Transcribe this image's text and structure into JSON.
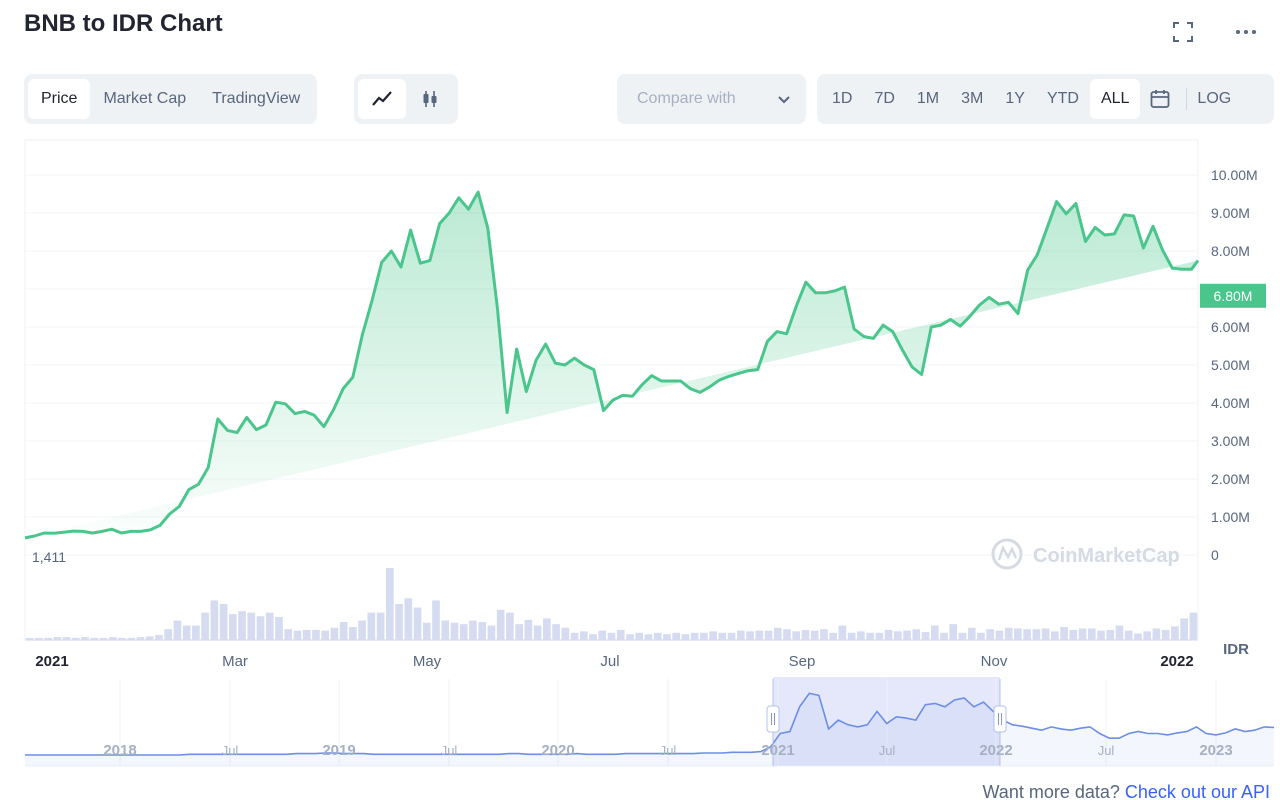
{
  "header": {
    "title": "BNB to IDR Chart",
    "fullscreen_icon": "fullscreen-icon",
    "more_icon": "more-icon"
  },
  "tabs": [
    {
      "label": "Price",
      "active": true
    },
    {
      "label": "Market Cap",
      "active": false
    },
    {
      "label": "TradingView",
      "active": false
    }
  ],
  "chart_style": {
    "line_icon": "line-chart-icon",
    "candle_icon": "candlestick-icon",
    "active": "line"
  },
  "compare": {
    "placeholder": "Compare with",
    "icon": "chevron-down-icon"
  },
  "ranges": [
    {
      "label": "1D",
      "active": false
    },
    {
      "label": "7D",
      "active": false
    },
    {
      "label": "1M",
      "active": false
    },
    {
      "label": "3M",
      "active": false
    },
    {
      "label": "1Y",
      "active": false
    },
    {
      "label": "YTD",
      "active": false
    },
    {
      "label": "ALL",
      "active": true
    }
  ],
  "calendar_icon": "calendar-icon",
  "log_label": "LOG",
  "footer": {
    "text": "Want more data?",
    "link": "Check out our API"
  },
  "colors": {
    "line": "#4ac68c",
    "brush": "#6c8ee6",
    "accent": "#3861fb"
  },
  "chart_data": {
    "type": "area",
    "x": [
      "2021-01-01",
      "2021-01-04",
      "2021-01-07",
      "2021-01-10",
      "2021-01-13",
      "2021-01-16",
      "2021-01-19",
      "2021-01-22",
      "2021-01-25",
      "2021-01-28",
      "2021-01-31",
      "2021-02-03",
      "2021-02-06",
      "2021-02-09",
      "2021-02-12",
      "2021-02-15",
      "2021-02-18",
      "2021-02-21",
      "2021-02-24",
      "2021-02-27",
      "2021-03-02",
      "2021-03-05",
      "2021-03-08",
      "2021-03-11",
      "2021-03-14",
      "2021-03-17",
      "2021-03-20",
      "2021-03-23",
      "2021-03-26",
      "2021-03-29",
      "2021-04-01",
      "2021-04-04",
      "2021-04-07",
      "2021-04-10",
      "2021-04-13",
      "2021-04-16",
      "2021-04-19",
      "2021-04-22",
      "2021-04-25",
      "2021-04-28",
      "2021-05-01",
      "2021-05-04",
      "2021-05-07",
      "2021-05-10",
      "2021-05-13",
      "2021-05-16",
      "2021-05-19",
      "2021-05-22",
      "2021-05-25",
      "2021-05-28",
      "2021-05-31",
      "2021-06-03",
      "2021-06-06",
      "2021-06-09",
      "2021-06-12",
      "2021-06-15",
      "2021-06-18",
      "2021-06-21",
      "2021-06-24",
      "2021-06-27",
      "2021-06-30",
      "2021-07-03",
      "2021-07-06",
      "2021-07-09",
      "2021-07-12",
      "2021-07-15",
      "2021-07-18",
      "2021-07-21",
      "2021-07-24",
      "2021-07-27",
      "2021-07-30",
      "2021-08-02",
      "2021-08-05",
      "2021-08-08",
      "2021-08-11",
      "2021-08-14",
      "2021-08-17",
      "2021-08-20",
      "2021-08-23",
      "2021-08-26",
      "2021-08-29",
      "2021-09-01",
      "2021-09-04",
      "2021-09-07",
      "2021-09-10",
      "2021-09-13",
      "2021-09-16",
      "2021-09-19",
      "2021-09-22",
      "2021-09-25",
      "2021-09-28",
      "2021-10-01",
      "2021-10-04",
      "2021-10-07",
      "2021-10-10",
      "2021-10-13",
      "2021-10-16",
      "2021-10-19",
      "2021-10-22",
      "2021-10-25",
      "2021-10-28",
      "2021-10-31",
      "2021-11-03",
      "2021-11-06",
      "2021-11-09",
      "2021-11-12",
      "2021-11-15",
      "2021-11-18",
      "2021-11-21",
      "2021-11-24",
      "2021-11-27",
      "2021-11-30",
      "2021-12-03",
      "2021-12-06",
      "2021-12-09",
      "2021-12-12",
      "2021-12-15",
      "2021-12-18",
      "2021-12-21",
      "2021-12-24",
      "2021-12-27",
      "2021-12-30",
      "2022-01-01"
    ],
    "price": [
      0.45,
      0.5,
      0.58,
      0.57,
      0.6,
      0.63,
      0.62,
      0.58,
      0.62,
      0.68,
      0.58,
      0.62,
      0.62,
      0.66,
      0.78,
      1.08,
      1.28,
      1.72,
      1.86,
      2.3,
      3.58,
      3.28,
      3.22,
      3.62,
      3.3,
      3.42,
      4.02,
      3.98,
      3.72,
      3.78,
      3.68,
      3.38,
      3.82,
      4.38,
      4.68,
      5.8,
      6.7,
      7.7,
      8.0,
      7.58,
      8.55,
      7.68,
      7.75,
      8.72,
      9.0,
      9.4,
      9.1,
      9.55,
      8.6,
      6.5,
      3.75,
      5.42,
      4.3,
      5.12,
      5.55,
      5.05,
      5.0,
      5.18,
      5.0,
      4.88,
      3.8,
      4.08,
      4.2,
      4.18,
      4.48,
      4.72,
      4.58,
      4.58,
      4.58,
      4.38,
      4.28,
      4.42,
      4.6,
      4.7,
      4.78,
      4.85,
      4.88,
      5.62,
      5.88,
      5.82,
      6.55,
      7.18,
      6.9,
      6.9,
      6.95,
      7.05,
      5.95,
      5.75,
      5.7,
      6.05,
      5.88,
      5.4,
      4.95,
      4.75,
      6.0,
      6.05,
      6.2,
      6.02,
      6.28,
      6.58,
      6.78,
      6.6,
      6.65,
      6.35,
      7.5,
      7.9,
      8.6,
      9.3,
      8.98,
      9.25,
      8.25,
      8.62,
      8.42,
      8.45,
      8.95,
      8.92,
      8.08,
      8.65,
      8.02,
      7.55,
      7.52,
      7.52,
      7.75,
      7.72,
      7.3,
      7.45,
      7.22,
      6.82
    ],
    "volume": [
      0.03,
      0.03,
      0.03,
      0.04,
      0.04,
      0.03,
      0.04,
      0.03,
      0.03,
      0.04,
      0.03,
      0.03,
      0.04,
      0.05,
      0.07,
      0.15,
      0.27,
      0.2,
      0.2,
      0.38,
      0.55,
      0.5,
      0.36,
      0.4,
      0.38,
      0.33,
      0.38,
      0.32,
      0.15,
      0.13,
      0.14,
      0.14,
      0.13,
      0.17,
      0.25,
      0.18,
      0.27,
      0.38,
      0.38,
      1.0,
      0.5,
      0.58,
      0.45,
      0.24,
      0.55,
      0.27,
      0.24,
      0.22,
      0.27,
      0.25,
      0.2,
      0.42,
      0.38,
      0.22,
      0.28,
      0.2,
      0.3,
      0.22,
      0.17,
      0.1,
      0.12,
      0.08,
      0.13,
      0.1,
      0.14,
      0.08,
      0.1,
      0.08,
      0.1,
      0.08,
      0.1,
      0.08,
      0.1,
      0.1,
      0.12,
      0.1,
      0.1,
      0.13,
      0.12,
      0.13,
      0.13,
      0.17,
      0.15,
      0.12,
      0.14,
      0.13,
      0.15,
      0.1,
      0.2,
      0.1,
      0.12,
      0.1,
      0.1,
      0.14,
      0.12,
      0.13,
      0.15,
      0.11,
      0.2,
      0.1,
      0.22,
      0.1,
      0.17,
      0.1,
      0.15,
      0.13,
      0.17,
      0.16,
      0.15,
      0.15,
      0.16,
      0.12,
      0.18,
      0.14,
      0.16,
      0.16,
      0.13,
      0.14,
      0.2,
      0.13,
      0.09,
      0.12,
      0.16,
      0.14,
      0.19,
      0.3,
      0.38
    ],
    "ylim": [
      0,
      10000000
    ],
    "y_ticks": [
      "10.00M",
      "9.00M",
      "8.00M",
      "7.00M",
      "6.00M",
      "5.00M",
      "4.00M",
      "3.00M",
      "2.00M",
      "1.00M",
      "0"
    ],
    "x_ticks": [
      "2021",
      "Mar",
      "May",
      "Jul",
      "Sep",
      "Nov",
      "2022"
    ],
    "current_price_label": "6.80M",
    "volume_label": "1,411",
    "currency_label": "IDR",
    "watermark": "CoinMarketCap",
    "navigator": {
      "x_ticks": [
        "2018",
        "Jul",
        "2019",
        "Jul",
        "2020",
        "Jul",
        "2021",
        "Jul",
        "2022",
        "Jul",
        "2023"
      ],
      "selected_range": [
        "2021-01-01",
        "2022-01-01"
      ],
      "series": [
        0.3,
        0.3,
        0.3,
        0.3,
        0.3,
        0.3,
        0.3,
        0.3,
        0.3,
        0.3,
        0.3,
        0.3,
        0.3,
        0.3,
        0.3,
        0.3,
        0.3,
        0.4,
        0.4,
        0.4,
        0.4,
        0.4,
        0.4,
        0.4,
        0.4,
        0.4,
        0.4,
        0.4,
        0.5,
        0.5,
        0.5,
        0.6,
        0.6,
        0.5,
        0.5,
        0.5,
        0.4,
        0.4,
        0.4,
        0.4,
        0.4,
        0.4,
        0.4,
        0.4,
        0.4,
        0.4,
        0.4,
        0.4,
        0.4,
        0.4,
        0.5,
        0.5,
        0.4,
        0.4,
        0.4,
        0.4,
        0.4,
        0.5,
        0.4,
        0.4,
        0.4,
        0.4,
        0.5,
        0.5,
        0.5,
        0.5,
        0.5,
        0.5,
        0.5,
        0.5,
        0.6,
        0.6,
        0.6,
        0.7,
        0.7,
        0.7,
        0.8,
        1.5,
        3.5,
        3.8,
        7.5,
        9.5,
        9.2,
        4.2,
        5.5,
        4.8,
        4.5,
        4.8,
        6.8,
        5.0,
        6.0,
        5.8,
        5.5,
        7.8,
        8.0,
        7.5,
        8.5,
        8.8,
        7.5,
        8.2,
        6.8,
        5.5,
        4.8,
        4.6,
        4.3,
        4.0,
        4.5,
        4.2,
        4.0,
        4.3,
        4.5,
        3.5,
        2.8,
        2.8,
        3.5,
        3.8,
        3.5,
        3.5,
        3.3,
        3.6,
        3.8,
        4.5,
        3.5,
        3.3,
        3.6,
        4.2,
        3.8,
        4.0,
        4.5,
        4.4
      ]
    }
  }
}
